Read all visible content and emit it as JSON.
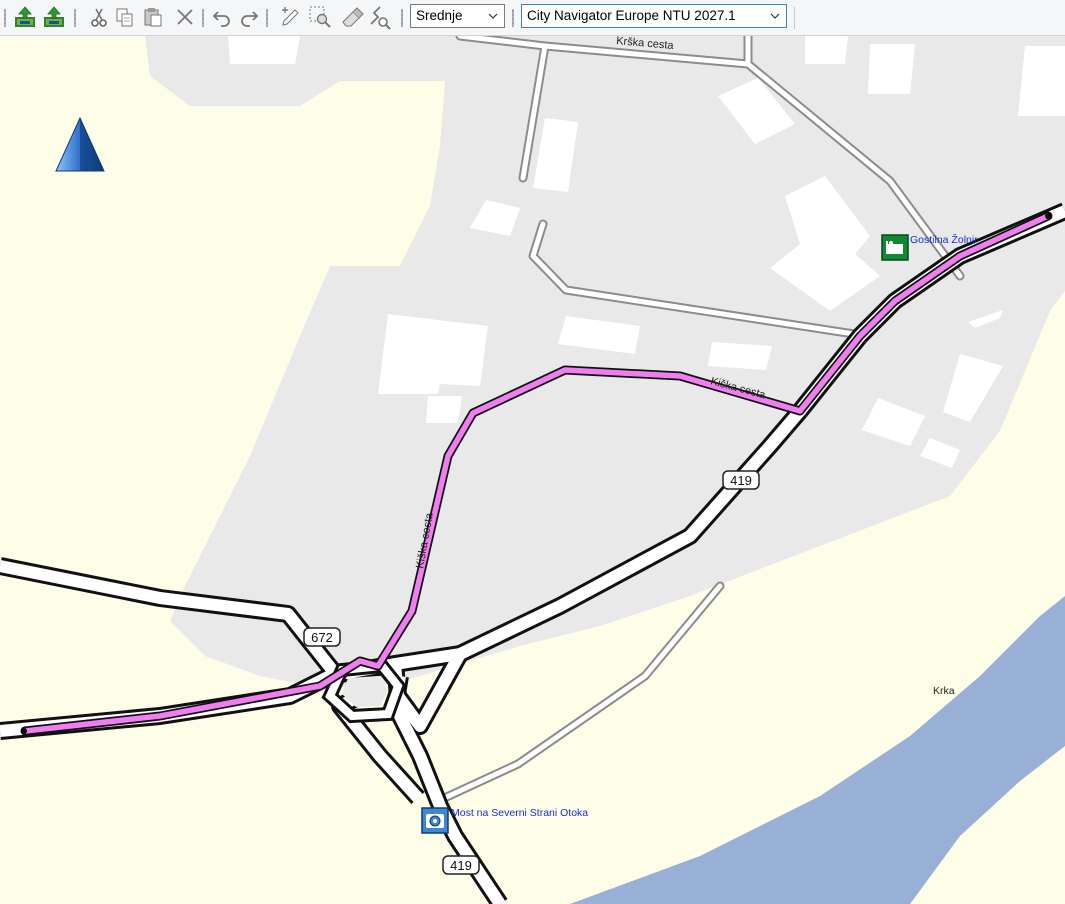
{
  "toolbar": {
    "icons": [
      "upload-to-device-icon",
      "upload-to-device-alt-icon",
      "cut-icon",
      "copy-icon",
      "paste-icon",
      "delete-icon",
      "undo-icon",
      "redo-icon",
      "new-waypoint-icon",
      "zoom-selection-icon",
      "eraser-icon",
      "route-tool-icon"
    ],
    "detail_level": "Srednje",
    "map_product": "City Navigator Europe NTU 2027.1"
  },
  "map": {
    "colors": {
      "land": "#fefee8",
      "urban": "#e9e9e9",
      "water": "#98b0d6",
      "building": "#ffffff",
      "route": "#f07ef0",
      "road_casing": "#111111",
      "minor_road_casing": "#8c8c8c",
      "poi_text": "#1c2bd8"
    },
    "road_labels": {
      "krska_cesta_top": "Krška cesta",
      "kiska_cesta_east": "Kiška cesta",
      "kiska_cesta_vertical": "Kiška cesta"
    },
    "shields": {
      "s419_upper": "419",
      "s672": "672",
      "s419_lower": "419"
    },
    "water_label": "Krka",
    "pois": {
      "gostilna": "Gostilna Žolnir",
      "most": "Most na Severni Strani Otoka"
    },
    "north_arrow": "north-arrow-icon"
  }
}
